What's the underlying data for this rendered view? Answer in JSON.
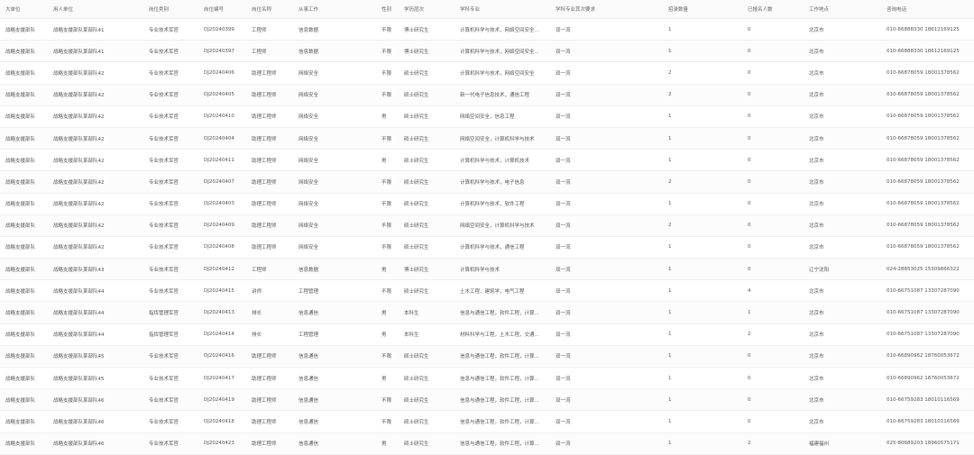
{
  "table": {
    "columns": [
      "大单位",
      "用人单位",
      "岗位类别",
      "岗位编号",
      "岗位名称",
      "从事工作",
      "性别",
      "学历层次",
      "学科专业",
      "学科专业其次要求",
      "招录数量",
      "已报名人数",
      "工作地点",
      "咨询电话"
    ],
    "rows": [
      [
        "战略支援部队",
        "战略支援部队某部队41",
        "专业技术军官",
        "DJ20240399",
        "工程师",
        "信息数据",
        "不限",
        "博士研究生",
        "计算机科学与技术，网络空间安全...",
        "双一流",
        "1",
        "0",
        "北京市",
        "010-66888330 18612169125"
      ],
      [
        "战略支援部队",
        "战略支援部队某部队41",
        "专业技术军官",
        "DJ20240397",
        "工程师",
        "信息数据",
        "不限",
        "博士研究生",
        "计算机科学与技术，网络空间安全...",
        "双一流",
        "1",
        "0",
        "北京市",
        "010-66888330 18612169125"
      ],
      [
        "战略支援部队",
        "战略支援部队某部队42",
        "专业技术军官",
        "DJ20240406",
        "助理工程师",
        "网络安全",
        "不限",
        "硕士研究生",
        "计算机科学与技术，网络空间安全",
        "双一流",
        "2",
        "0",
        "北京市",
        "010-66878059 18001378562"
      ],
      [
        "战略支援部队",
        "战略支援部队某部队42",
        "专业技术军官",
        "DJ20240405",
        "助理工程师",
        "网络安全",
        "不限",
        "硕士研究生",
        "新一代电子信息技术，通信工程",
        "双一流",
        "2",
        "0",
        "北京市",
        "010-66878059 18001378562"
      ],
      [
        "战略支援部队",
        "战略支援部队某部队42",
        "专业技术军官",
        "DJ20240410",
        "助理工程师",
        "网络安全",
        "男",
        "硕士研究生",
        "网络空间安全，信息工程",
        "双一流",
        "1",
        "0",
        "北京市",
        "010-66878059 18001378562"
      ],
      [
        "战略支援部队",
        "战略支援部队某部队42",
        "专业技术军官",
        "DJ20240404",
        "助理工程师",
        "网络安全",
        "不限",
        "硕士研究生",
        "网络空间安全，计算机科学与技术",
        "双一流",
        "1",
        "0",
        "北京市",
        "010-66878059 18001378562"
      ],
      [
        "战略支援部队",
        "战略支援部队某部队42",
        "专业技术军官",
        "DJ20240411",
        "助理工程师",
        "网络安全",
        "男",
        "硕士研究生",
        "计算机科学与技术，计算机技术",
        "双一流",
        "1",
        "0",
        "北京市",
        "010-66878059 18001378562"
      ],
      [
        "战略支援部队",
        "战略支援部队某部队42",
        "专业技术军官",
        "DJ20240407",
        "助理工程师",
        "网络安全",
        "不限",
        "硕士研究生",
        "计算机科学与技术，电子信息",
        "双一流",
        "2",
        "0",
        "北京市",
        "010-66878059 18001378562"
      ],
      [
        "战略支援部队",
        "战略支援部队某部队42",
        "专业技术军官",
        "DJ20240403",
        "助理工程师",
        "网络安全",
        "不限",
        "硕士研究生",
        "计算机科学与技术，软件工程",
        "双一流",
        "1",
        "0",
        "北京市",
        "010-66878059 18001378562"
      ],
      [
        "战略支援部队",
        "战略支援部队某部队42",
        "专业技术军官",
        "DJ20240409",
        "助理工程师",
        "网络安全",
        "不限",
        "硕士研究生",
        "网络空间安全，计算机科学与技术",
        "双一流",
        "2",
        "0",
        "北京市",
        "010-66878059 18001378562"
      ],
      [
        "战略支援部队",
        "战略支援部队某部队42",
        "专业技术军官",
        "DJ20240408",
        "助理工程师",
        "网络安全",
        "不限",
        "硕士研究生",
        "计算机科学与技术，通信工程",
        "双一流",
        "1",
        "0",
        "北京市",
        "010-66878059 18001378562"
      ],
      [
        "战略支援部队",
        "战略支援部队某部队43",
        "专业技术军官",
        "DJ20240412",
        "工程师",
        "信息数据",
        "男",
        "博士研究生",
        "计算机科学与技术",
        "双一流",
        "1",
        "0",
        "辽宁沈阳",
        "024-28853025 15309866322"
      ],
      [
        "战略支援部队",
        "战略支援部队某部队44",
        "专业技术军官",
        "DJ20240415",
        "讲师",
        "工程管理",
        "不限",
        "硕士研究生",
        "土木工程，建筑学，电气工程",
        "双一流",
        "1",
        "4",
        "北京市",
        "010-66751087 13307287090"
      ],
      [
        "战略支援部队",
        "战略支援部队某部队44",
        "指挥管理军官",
        "DJ20240413",
        "排长",
        "信息通信",
        "男",
        "本科生",
        "信息与通信工程，软件工程，计算...",
        "双一流",
        "1",
        "1",
        "北京市",
        "010-66751087 13307287090"
      ],
      [
        "战略支援部队",
        "战略支援部队某部队44",
        "指挥管理军官",
        "DJ20240414",
        "排长",
        "工程管理",
        "男",
        "本科生",
        "材料科学与工程，土木工程，交通...",
        "双一流",
        "1",
        "2",
        "北京市",
        "010-66751087 13307287090"
      ],
      [
        "战略支援部队",
        "战略支援部队某部队45",
        "专业技术军官",
        "DJ20240416",
        "助理工程师",
        "信息通信",
        "不限",
        "硕士研究生",
        "信息与通信工程，软件工程，计算...",
        "双一流",
        "1",
        "0",
        "北京市",
        "010-66890962 18760053672"
      ],
      [
        "战略支援部队",
        "战略支援部队某部队45",
        "专业技术军官",
        "DJ20240417",
        "助理工程师",
        "信息通信",
        "男",
        "硕士研究生",
        "信息与通信工程，软件工程，计算...",
        "双一流",
        "1",
        "0",
        "北京市",
        "010-66890962 18760053672"
      ],
      [
        "战略支援部队",
        "战略支援部队某部队46",
        "专业技术军官",
        "DJ20240419",
        "助理工程师",
        "信息通信",
        "不限",
        "硕士研究生",
        "信息与通信工程，软件工程，计算...",
        "双一流",
        "1",
        "0",
        "北京市",
        "010-66759283 18010116569"
      ],
      [
        "战略支援部队",
        "战略支援部队某部队46",
        "专业技术军官",
        "DJ20240418",
        "助理工程师",
        "信息通信",
        "不限",
        "硕士研究生",
        "信息与通信工程，软件工程，计算...",
        "双一流",
        "1",
        "0",
        "北京市",
        "010-66759283 18010116569"
      ],
      [
        "战略支援部队",
        "战略支援部队某部队46",
        "专业技术军官",
        "DJ20240423",
        "助理工程师",
        "信息通信",
        "男",
        "硕士研究生",
        "信息与通信工程，软件工程，计算...",
        "双一流",
        "1",
        "2",
        "福建福州",
        "025-80689203 18960575171"
      ]
    ]
  }
}
